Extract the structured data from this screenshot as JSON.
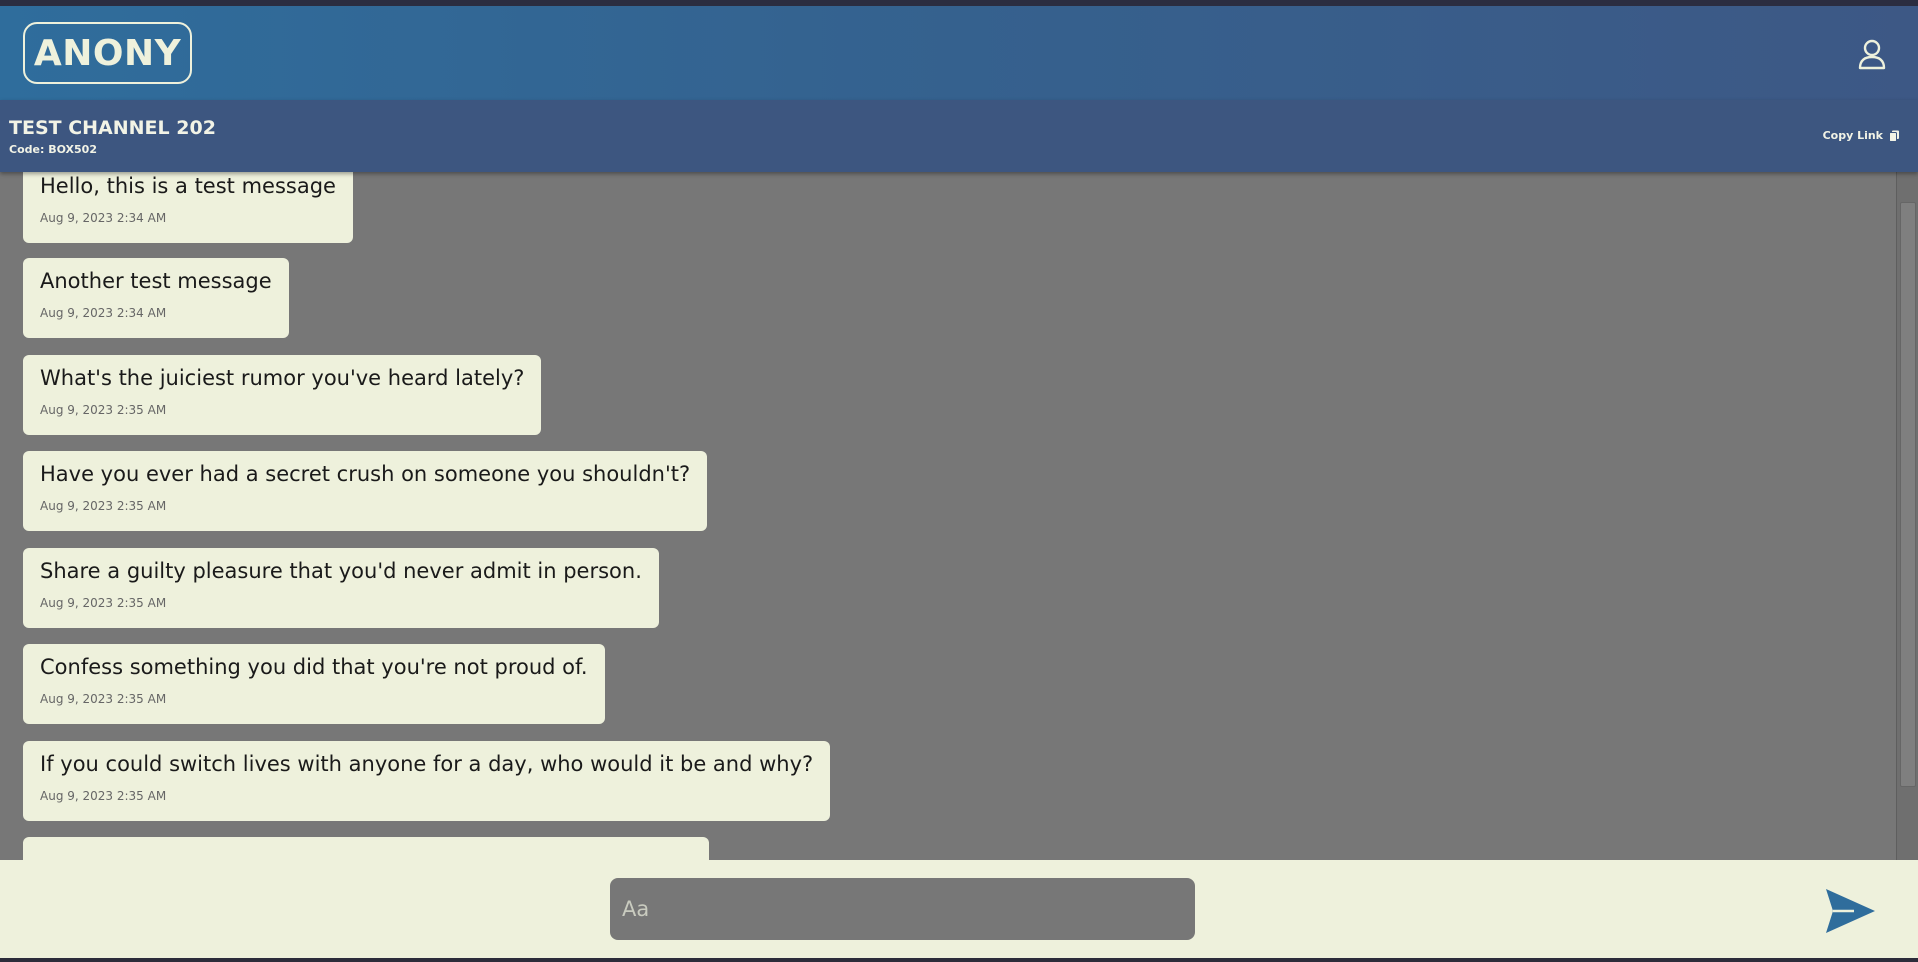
{
  "app": {
    "logo_text": "ANONY"
  },
  "channel": {
    "title": "TEST CHANNEL 202",
    "code": "Code: BOX502",
    "copy_link_label": "Copy Link"
  },
  "messages": [
    {
      "text": "Hello, this is a test message",
      "time": "Aug 9, 2023 2:34 AM"
    },
    {
      "text": "Another test message",
      "time": "Aug 9, 2023 2:34 AM"
    },
    {
      "text": "What's the juiciest rumor you've heard lately?",
      "time": "Aug 9, 2023 2:35 AM"
    },
    {
      "text": "Have you ever had a secret crush on someone you shouldn't?",
      "time": "Aug 9, 2023 2:35 AM"
    },
    {
      "text": "Share a guilty pleasure that you'd never admit in person.",
      "time": "Aug 9, 2023 2:35 AM"
    },
    {
      "text": "Confess something you did that you're not proud of.",
      "time": "Aug 9, 2023 2:35 AM"
    },
    {
      "text": "If you could switch lives with anyone for a day, who would it be and why?",
      "time": "Aug 9, 2023 2:35 AM"
    }
  ],
  "composer": {
    "placeholder": "Aa",
    "value": ""
  },
  "icons": {
    "profile": "user-icon",
    "copy": "copy-icon",
    "send": "send-icon"
  },
  "colors": {
    "header": "#2f6d9c",
    "channel_bar": "#3d5680",
    "message_bg": "#eef1dc",
    "feed_bg": "#777777",
    "send_icon": "#2f6d9c"
  }
}
